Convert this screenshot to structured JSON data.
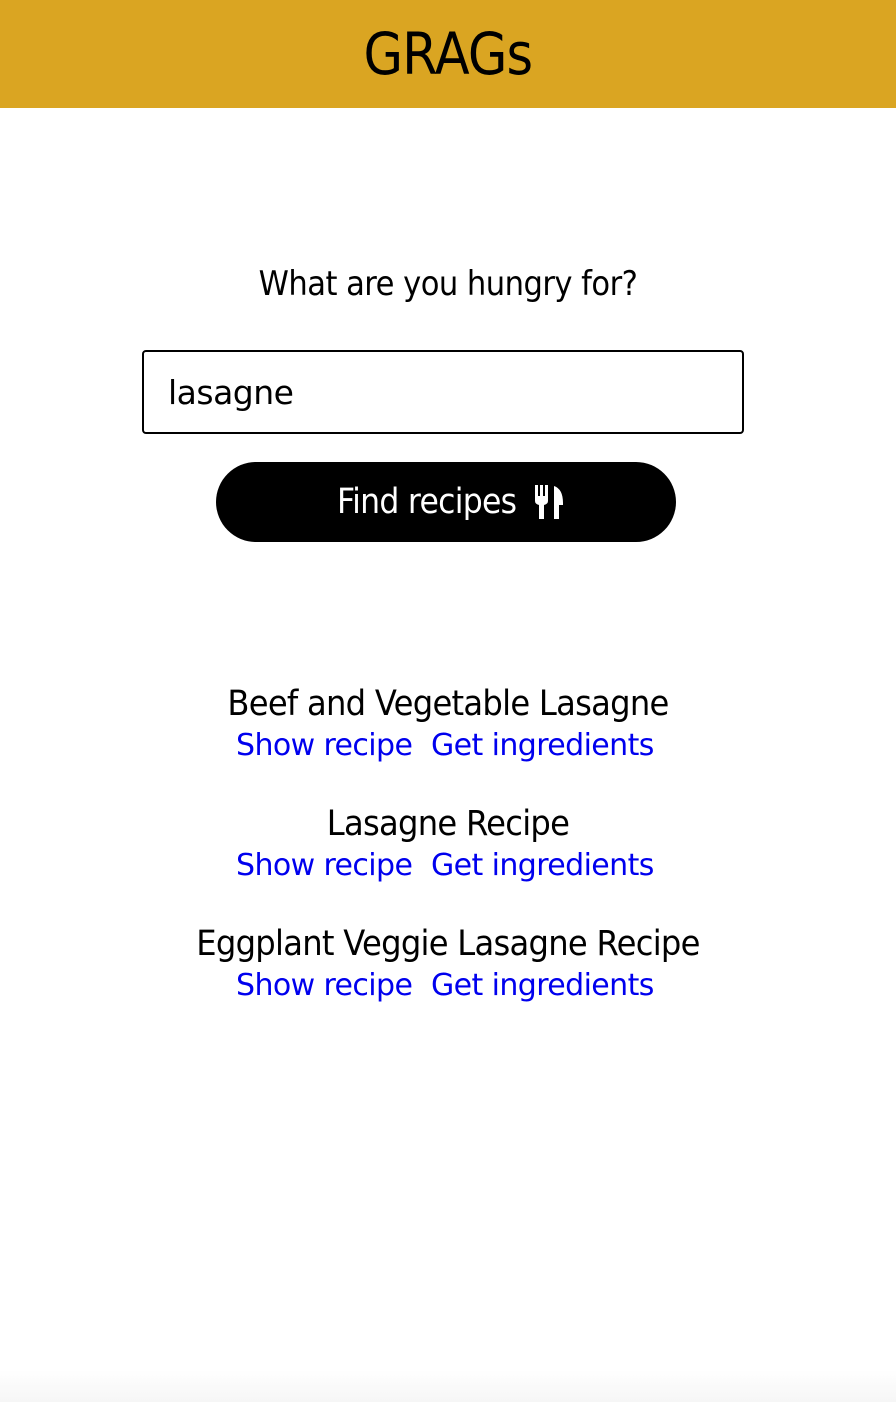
{
  "header": {
    "title": "GRAGs",
    "background_color": "#DAA522"
  },
  "search": {
    "prompt": "What are you hungry for?",
    "value": "lasagne",
    "button_label": "Find recipes",
    "button_icon": "utensils-icon"
  },
  "results": [
    {
      "title": "Beef and Vegetable Lasagne",
      "show_label": "Show recipe",
      "ingredients_label": "Get ingredients"
    },
    {
      "title": "Lasagne Recipe",
      "show_label": "Show recipe",
      "ingredients_label": "Get ingredients"
    },
    {
      "title": "Eggplant Veggie Lasagne Recipe",
      "show_label": "Show recipe",
      "ingredients_label": "Get ingredients"
    }
  ],
  "colors": {
    "accent": "#DAA522",
    "link": "#0000EE",
    "button": "#000000"
  }
}
